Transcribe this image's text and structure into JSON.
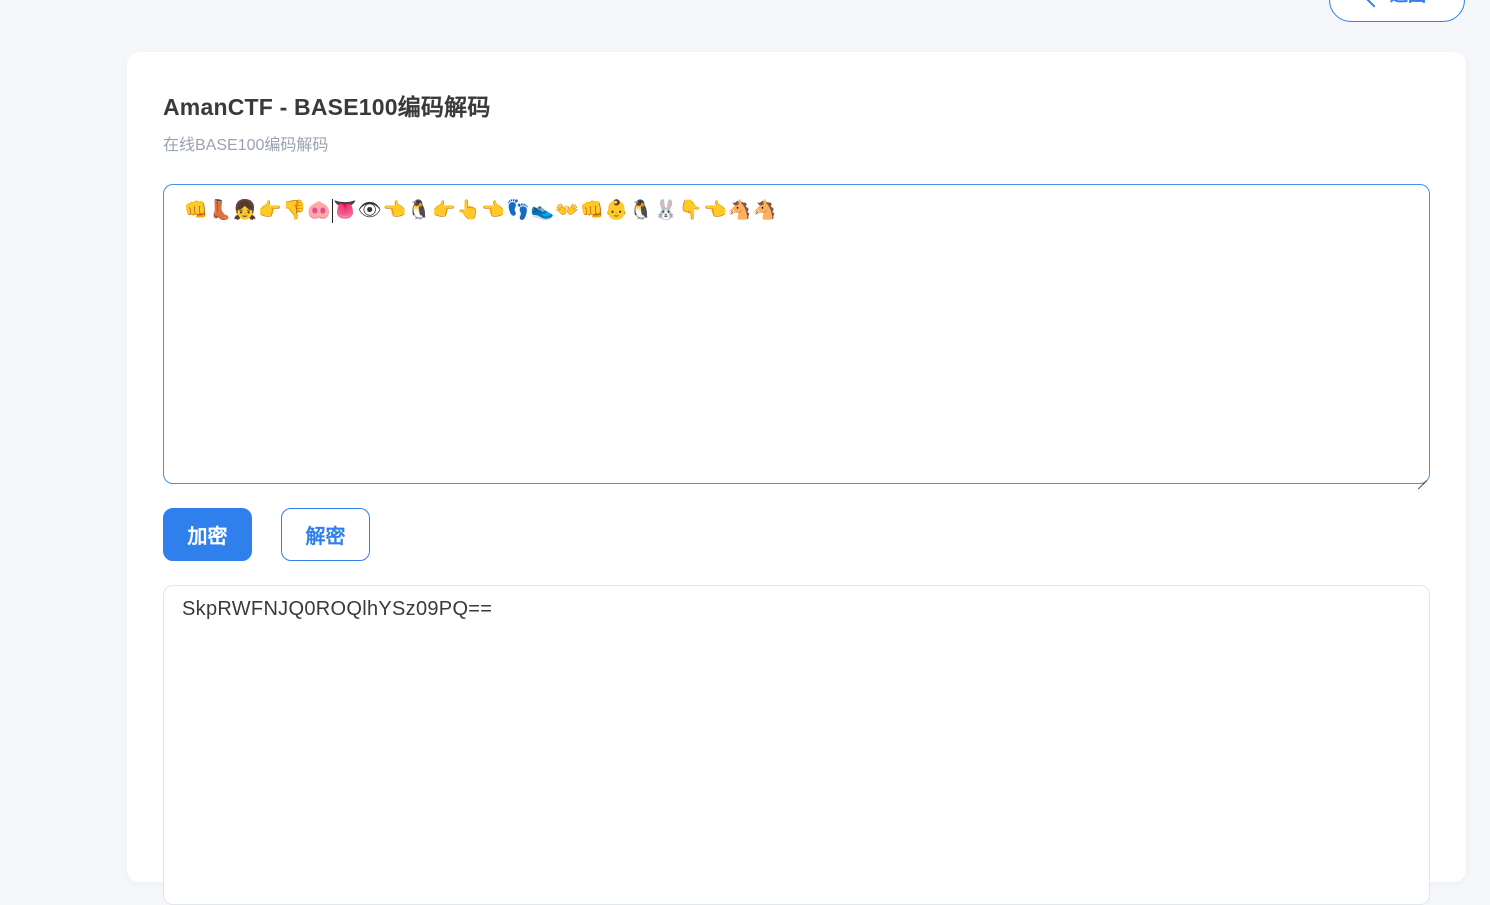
{
  "header": {
    "back_label": "返回",
    "back_icon": "chevron-left-icon"
  },
  "card": {
    "title": "AmanCTF - BASE100编码解码",
    "subtitle": "在线BASE100编码解码"
  },
  "input": {
    "value_before_caret": "👊👢👧👉👎🐽",
    "value_after_caret": "👅👁👈🐧👉👆👈👣👟👐👊👶🐧🐰👇👈🐴🐴"
  },
  "actions": {
    "encrypt_label": "加密",
    "decrypt_label": "解密"
  },
  "output": {
    "value": "SkpRWFNJQ0ROQlhYSz09PQ=="
  },
  "colors": {
    "accent": "#2f80ed",
    "background": "#f5f7fa",
    "card": "#ffffff"
  }
}
